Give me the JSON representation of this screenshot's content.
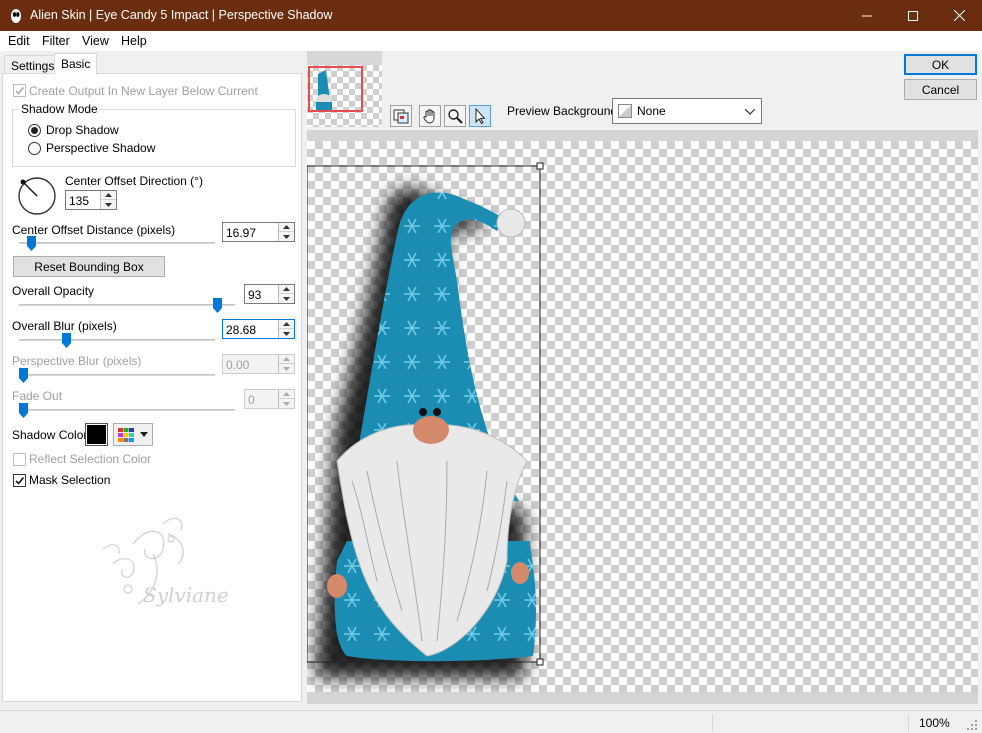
{
  "window": {
    "title": "Alien Skin | Eye Candy 5 Impact | Perspective Shadow",
    "title_bg": "#6b2d0f"
  },
  "menu": [
    {
      "label": "Edit"
    },
    {
      "label": "Filter"
    },
    {
      "label": "View"
    },
    {
      "label": "Help"
    }
  ],
  "tabs": {
    "settings": "Settings",
    "basic": "Basic"
  },
  "basic": {
    "create_output_label": "Create Output In New Layer Below Current",
    "shadow_mode": {
      "title": "Shadow Mode",
      "drop": "Drop Shadow",
      "perspective": "Perspective Shadow",
      "selected": "Drop Shadow"
    },
    "direction": {
      "label": "Center Offset Direction (°)",
      "value": "135"
    },
    "distance": {
      "label": "Center Offset Distance (pixels)",
      "value": "16.97",
      "slider_fraction": 0.08
    },
    "reset_button": "Reset Bounding Box",
    "opacity": {
      "label": "Overall Opacity",
      "value": "93",
      "slider_fraction": 0.93
    },
    "blur": {
      "label": "Overall Blur (pixels)",
      "value": "28.68",
      "slider_fraction": 0.24
    },
    "perspective_blur": {
      "label": "Perspective Blur (pixels)",
      "value": "0.00",
      "slider_fraction": 0.0
    },
    "fade_out": {
      "label": "Fade Out",
      "value": "0",
      "slider_fraction": 0.0
    },
    "shadow_color": {
      "label": "Shadow Color",
      "color": "#000000"
    },
    "reflect_label": "Reflect Selection Color",
    "mask_label": "Mask Selection",
    "mask_checked": true
  },
  "watermark": "Sylviane",
  "toolbar": {
    "tools": [
      "navigator-icon",
      "hand-icon",
      "zoom-icon",
      "arrow-icon"
    ],
    "preview_bg_label": "Preview Background:",
    "preview_bg_value": "None"
  },
  "buttons": {
    "ok": "OK",
    "cancel": "Cancel"
  },
  "status": {
    "zoom": "100%"
  },
  "colors": {
    "accent": "#0078d7",
    "hat": "#1b8db3"
  }
}
